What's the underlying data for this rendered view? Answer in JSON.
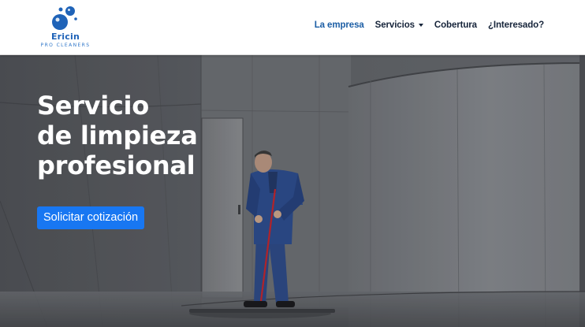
{
  "brand": {
    "name": "Ericin",
    "tagline": "PRO CLEANERS",
    "logo_icon": "bubbles-logo-icon",
    "color": "#1f63b8"
  },
  "nav": {
    "items": [
      {
        "label": "La empresa",
        "active": true
      },
      {
        "label": "Servicios",
        "has_dropdown": true
      },
      {
        "label": "Cobertura"
      },
      {
        "label": "¿Interesado?"
      }
    ]
  },
  "hero": {
    "title_lines": [
      "Servicio",
      "de limpieza",
      "profesional"
    ],
    "cta_label": "Solicitar cotización",
    "cta_color": "#1877f2",
    "background_image": "janitor-mopping-floor-photo"
  }
}
